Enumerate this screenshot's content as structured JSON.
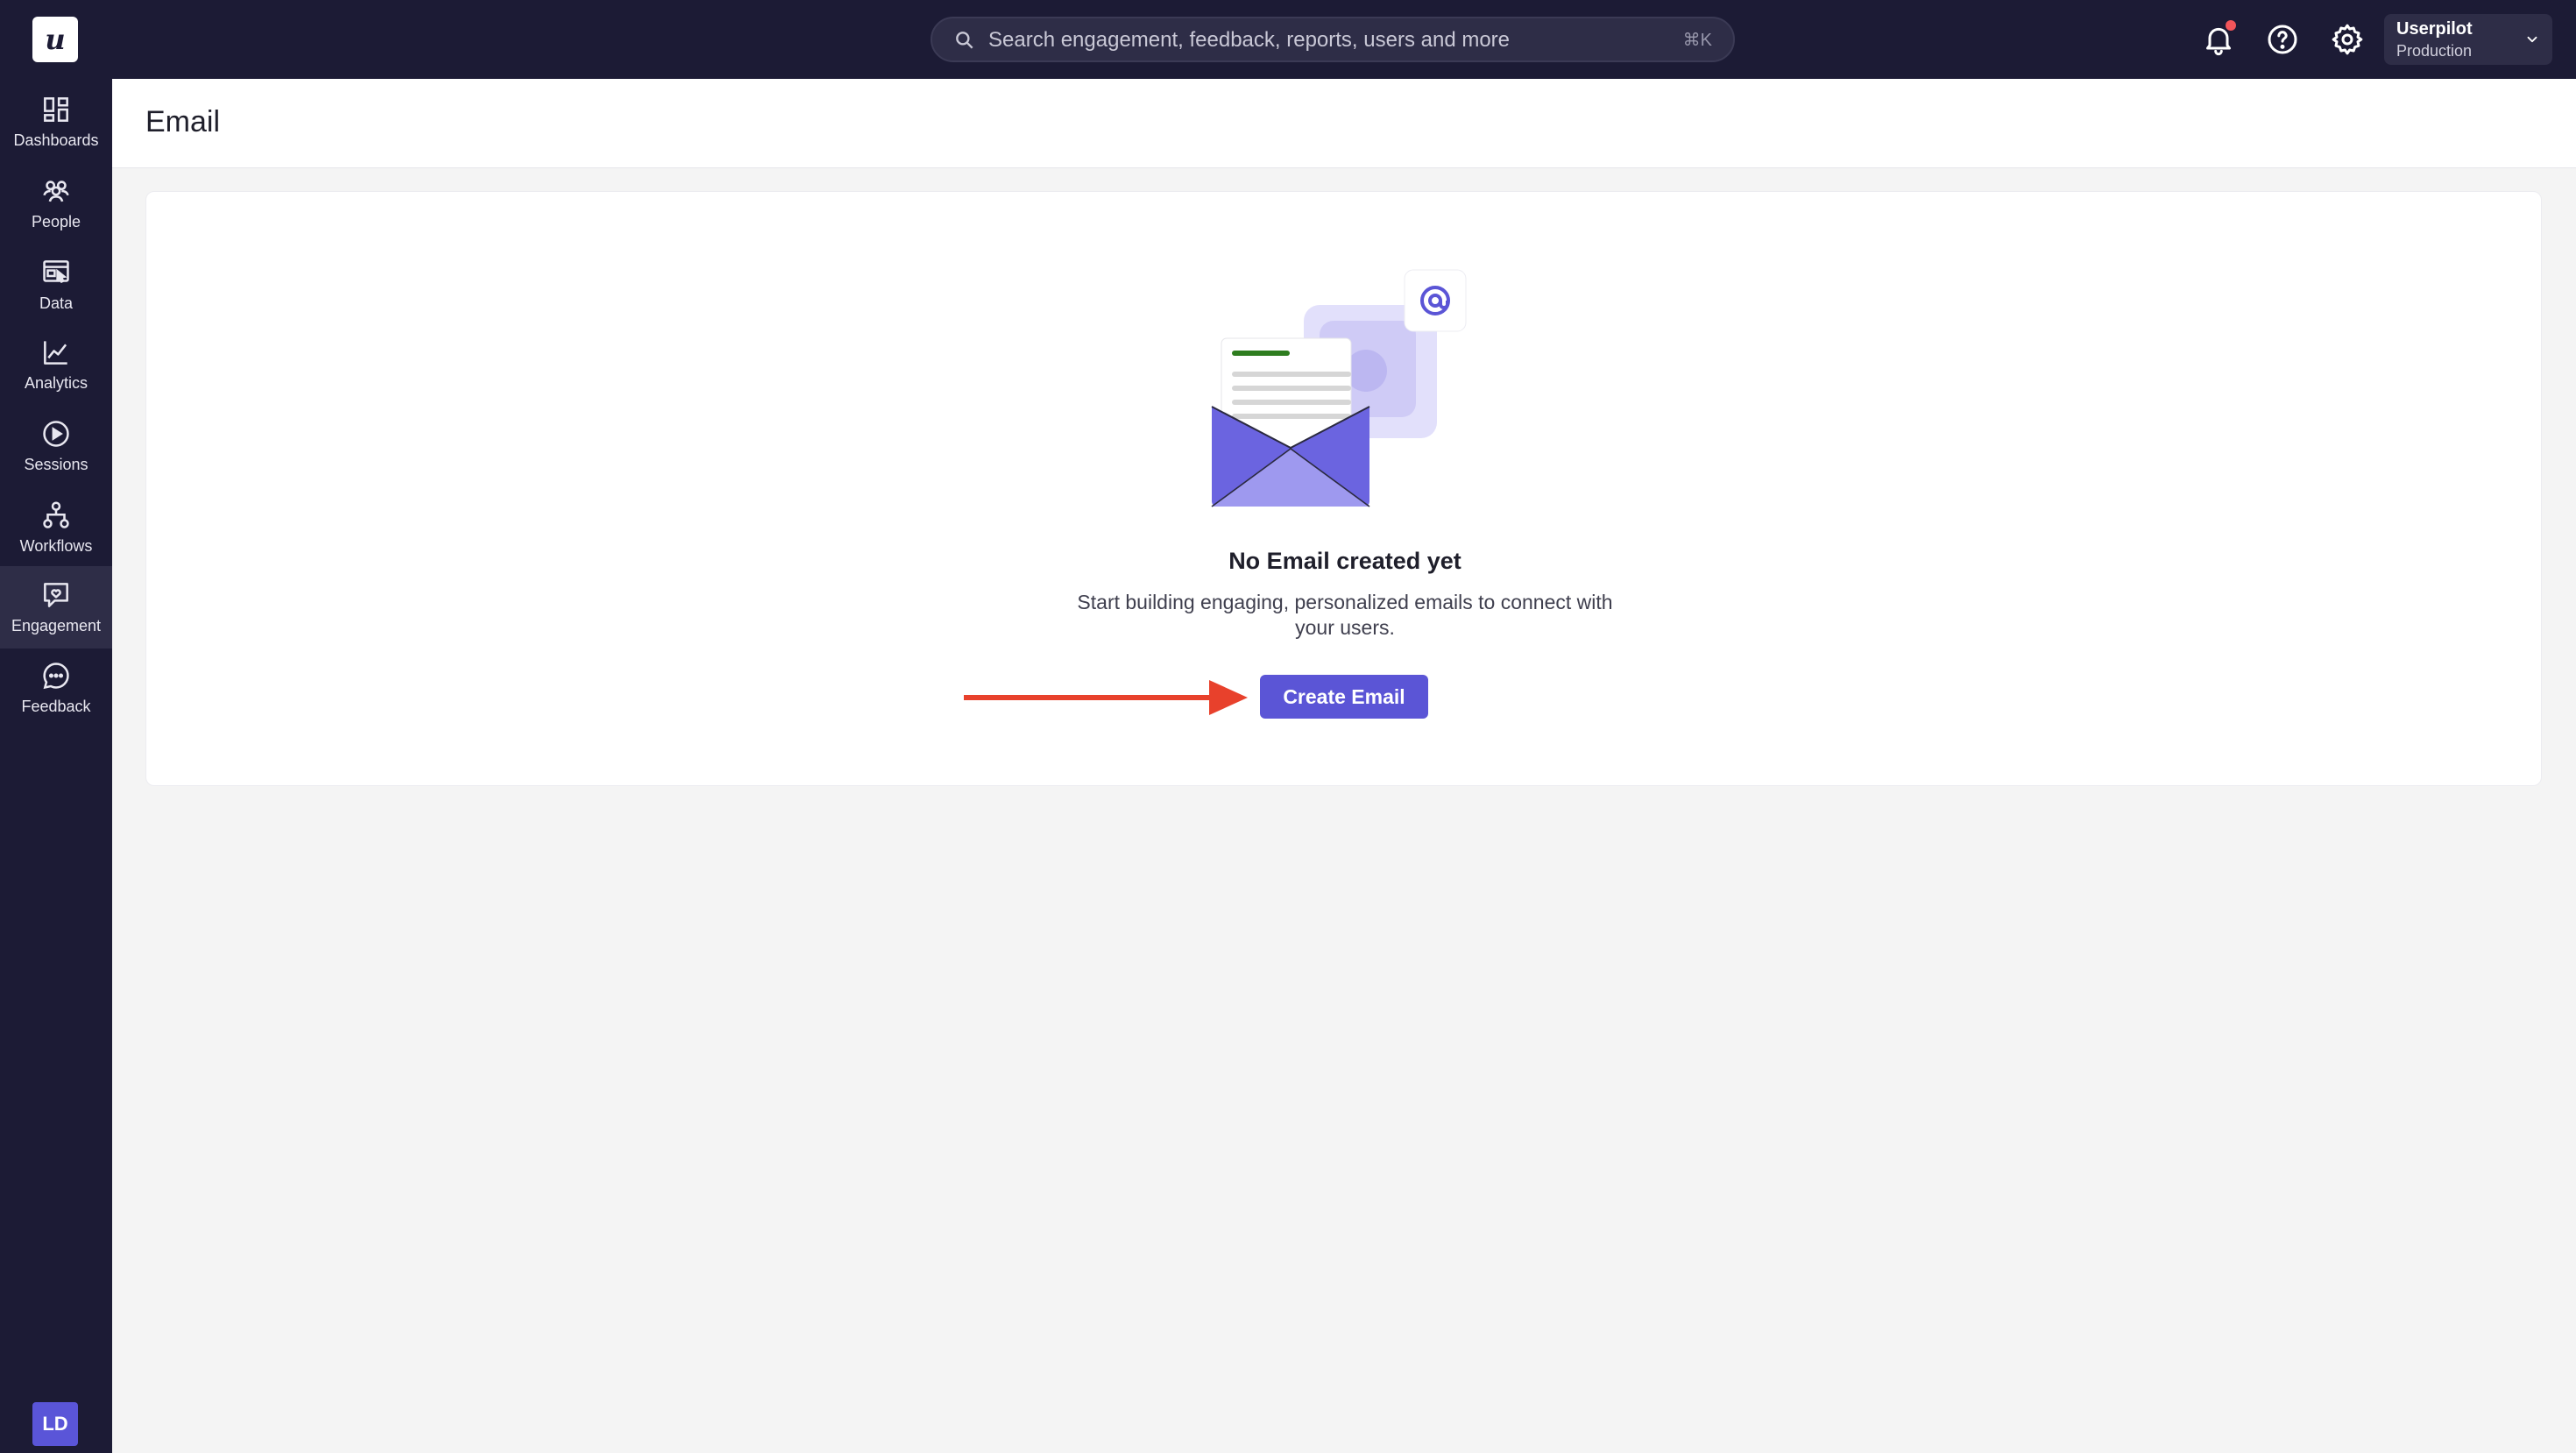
{
  "app": {
    "logo_letter": "u"
  },
  "search": {
    "placeholder": "Search engagement, feedback, reports, users and more",
    "shortcut": "⌘K"
  },
  "account": {
    "name": "Userpilot",
    "environment": "Production"
  },
  "sidebar": {
    "items": [
      {
        "label": "Dashboards",
        "icon": "dashboards-icon"
      },
      {
        "label": "People",
        "icon": "people-icon"
      },
      {
        "label": "Data",
        "icon": "data-icon"
      },
      {
        "label": "Analytics",
        "icon": "analytics-icon"
      },
      {
        "label": "Sessions",
        "icon": "sessions-icon"
      },
      {
        "label": "Workflows",
        "icon": "workflows-icon"
      },
      {
        "label": "Engagement",
        "icon": "engagement-icon",
        "active": true
      },
      {
        "label": "Feedback",
        "icon": "feedback-icon"
      }
    ],
    "user_initials": "LD"
  },
  "page": {
    "title": "Email"
  },
  "empty_state": {
    "title": "No Email created yet",
    "description": "Start building engaging, personalized emails to connect with your users.",
    "button_label": "Create Email"
  },
  "colors": {
    "nav_bg": "#1c1b35",
    "accent": "#5b55d6",
    "annotation_arrow": "#e8412c",
    "notification_dot": "#f2555a"
  }
}
